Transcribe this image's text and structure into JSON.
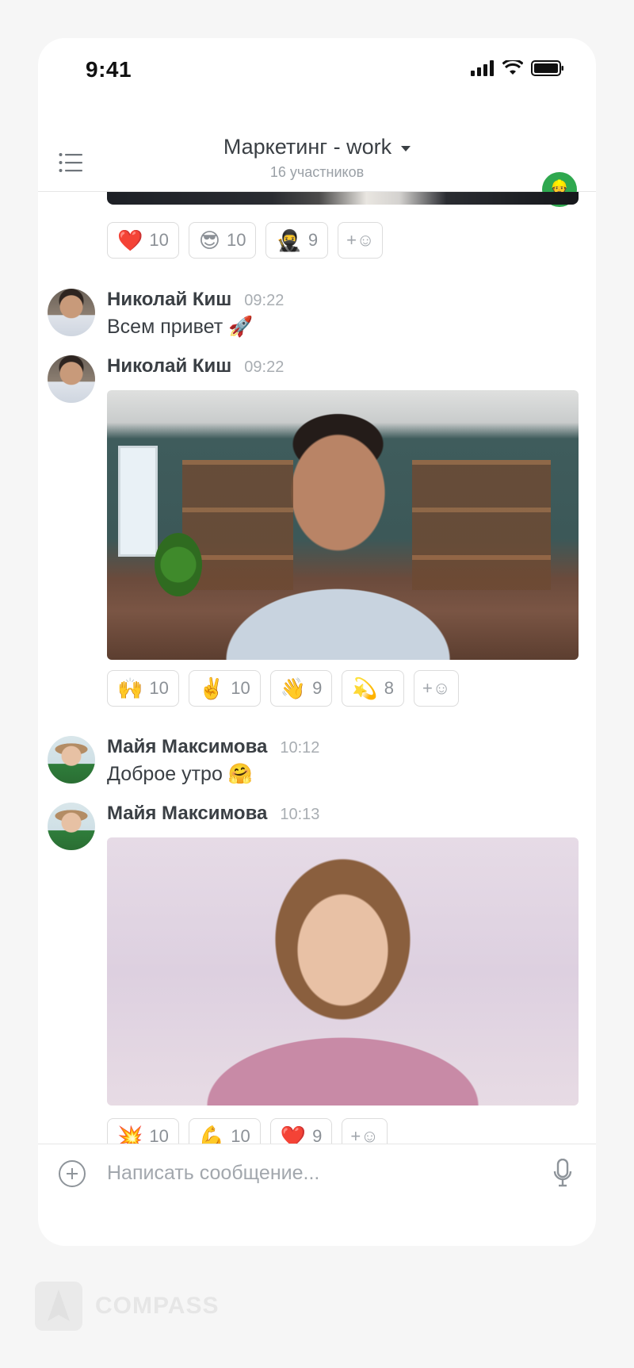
{
  "status_bar": {
    "time": "9:41"
  },
  "header": {
    "title": "Маркетинг - work",
    "subtitle": "16 участников",
    "avatar_emoji": "👷"
  },
  "messages": [
    {
      "reactions": [
        {
          "emoji": "❤️",
          "count": "10"
        },
        {
          "emoji": "😎",
          "count": "10"
        },
        {
          "emoji": "🥷",
          "count": "9"
        }
      ],
      "add_reaction": "+☺"
    },
    {
      "author": "Николай Киш",
      "time": "09:22",
      "text": "Всем привет 🚀"
    },
    {
      "author": "Николай Киш",
      "time": "09:22",
      "image_alt": "photo-man-office",
      "reactions": [
        {
          "emoji": "🙌",
          "count": "10"
        },
        {
          "emoji": "✌️",
          "count": "10"
        },
        {
          "emoji": "👋",
          "count": "9"
        },
        {
          "emoji": "💫",
          "count": "8"
        }
      ],
      "add_reaction": "+☺"
    },
    {
      "author": "Майя Максимова",
      "time": "10:12",
      "text": "Доброе утро  🤗"
    },
    {
      "author": "Майя Максимова",
      "time": "10:13",
      "image_alt": "photo-woman-portrait",
      "reactions": [
        {
          "emoji": "💥",
          "count": "10"
        },
        {
          "emoji": "💪",
          "count": "10"
        },
        {
          "emoji": "❤️",
          "count": "9"
        }
      ],
      "add_reaction": "+☺"
    }
  ],
  "composer": {
    "placeholder": "Написать сообщение..."
  },
  "brand": {
    "name": "COMPASS"
  },
  "colors": {
    "accent_green": "#2fa84f",
    "text_primary": "#3a3f44",
    "text_muted": "#a8adb2"
  }
}
